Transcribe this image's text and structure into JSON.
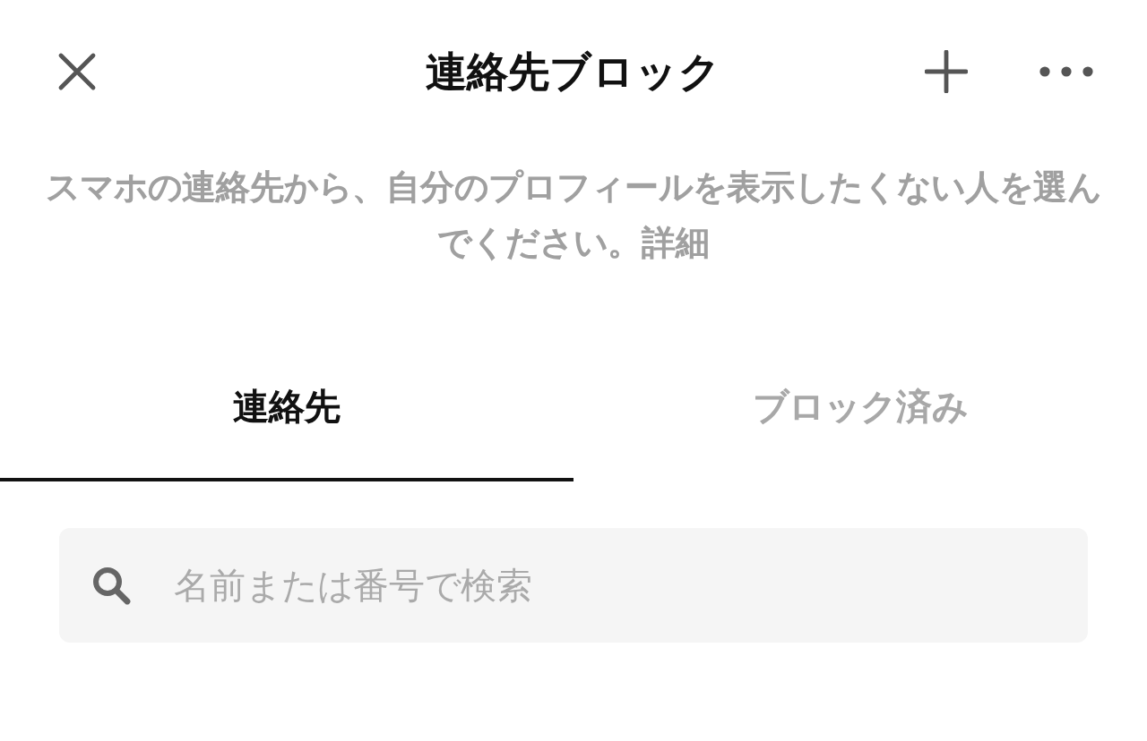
{
  "header": {
    "title": "連絡先ブロック"
  },
  "description": {
    "text": "スマホの連絡先から、自分のプロフィールを表示したくない人を選んでください。",
    "link": "詳細"
  },
  "tabs": [
    {
      "label": "連絡先",
      "selected": true
    },
    {
      "label": "ブロック済み",
      "selected": false
    }
  ],
  "search": {
    "placeholder": "名前または番号で検索"
  }
}
